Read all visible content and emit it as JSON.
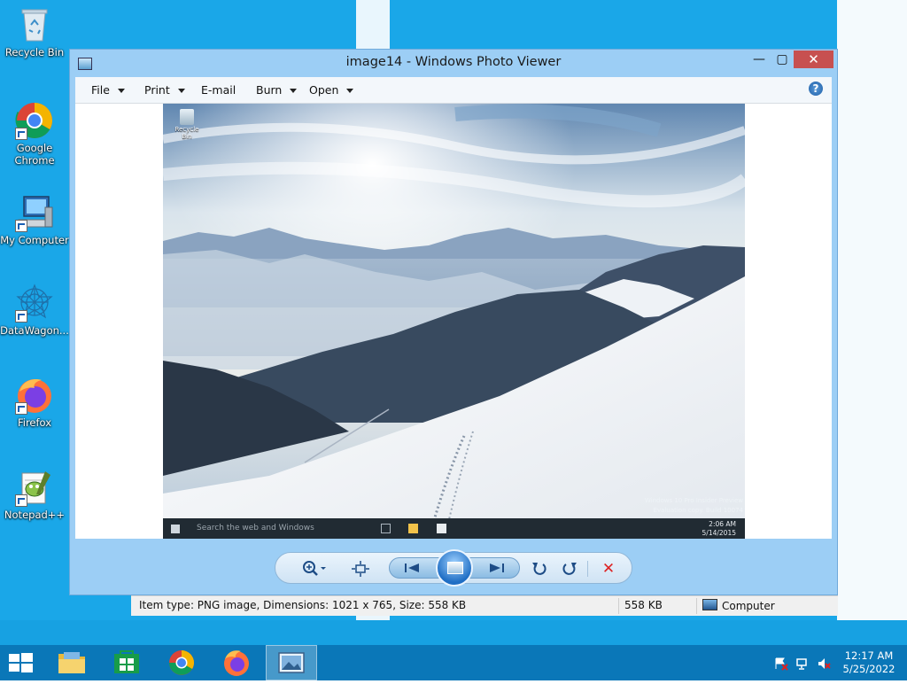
{
  "desktop": {
    "icons": [
      {
        "label": "Recycle Bin"
      },
      {
        "label": "Google Chrome"
      },
      {
        "label": "My Computer"
      },
      {
        "label": "DataWagon..."
      },
      {
        "label": "Firefox"
      },
      {
        "label": "Notepad++"
      }
    ]
  },
  "window": {
    "title": "image14 - Windows Photo Viewer",
    "controls": {
      "minimize": "—",
      "maximize": "▢",
      "close": "✕"
    },
    "menu": [
      {
        "label": "File",
        "has_dropdown": true
      },
      {
        "label": "Print",
        "has_dropdown": true
      },
      {
        "label": "E-mail",
        "has_dropdown": false
      },
      {
        "label": "Burn",
        "has_dropdown": true
      },
      {
        "label": "Open",
        "has_dropdown": true
      }
    ],
    "help_icon": "help-icon"
  },
  "photo": {
    "desktop_icon_label": "Recycle Bin",
    "search_text": "Search the web and Windows",
    "watermark_line1": "Windows 10 Pro Insider Preview",
    "watermark_line2": "Evaluation copy. Build 10074",
    "clock_time": "2:06 AM",
    "clock_date": "5/14/2015"
  },
  "toolbar": {
    "zoom": "zoom-icon",
    "fit": "actual-size-icon",
    "previous": "previous-icon",
    "slideshow": "slideshow-icon",
    "next": "next-icon",
    "rotate_ccw": "rotate-counterclockwise-icon",
    "rotate_cw": "rotate-clockwise-icon",
    "delete": "delete-icon"
  },
  "statusbar": {
    "info": "Item type: PNG image, Dimensions: 1021 x 765, Size: 558 KB",
    "size": "558 KB",
    "location": "Computer"
  },
  "taskbar": {
    "apps": [
      "file-explorer",
      "store",
      "google-chrome",
      "firefox",
      "photo-viewer"
    ],
    "active_app": "photo-viewer",
    "clock_time": "12:17 AM",
    "clock_date": "5/25/2022"
  },
  "colors": {
    "wallpaper": "#1aa7e8",
    "window_frame": "#9ccef5",
    "close_button": "#c75050",
    "taskbar": "#0a77b8"
  }
}
